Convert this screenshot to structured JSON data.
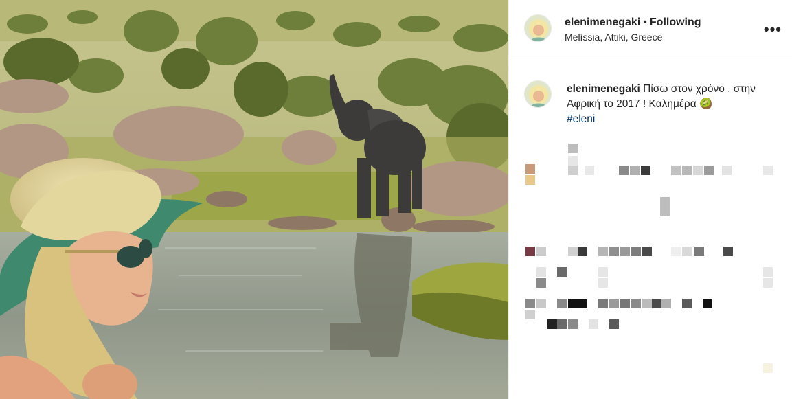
{
  "post": {
    "username": "elenimenegaki",
    "separator": "•",
    "follow_status": "Following",
    "location": "Melíssia, Attiki, Greece",
    "more_label": "•••",
    "caption": {
      "username": "elenimenegaki",
      "text": "Πίσω στον χρόνο , στην Αφρική το 2017 ! Καλημέρα",
      "emoji": "🥝",
      "hashtag": "#eleni"
    }
  },
  "colors": {
    "text": "#262626",
    "hashtag": "#003569",
    "divider": "#efefef"
  }
}
